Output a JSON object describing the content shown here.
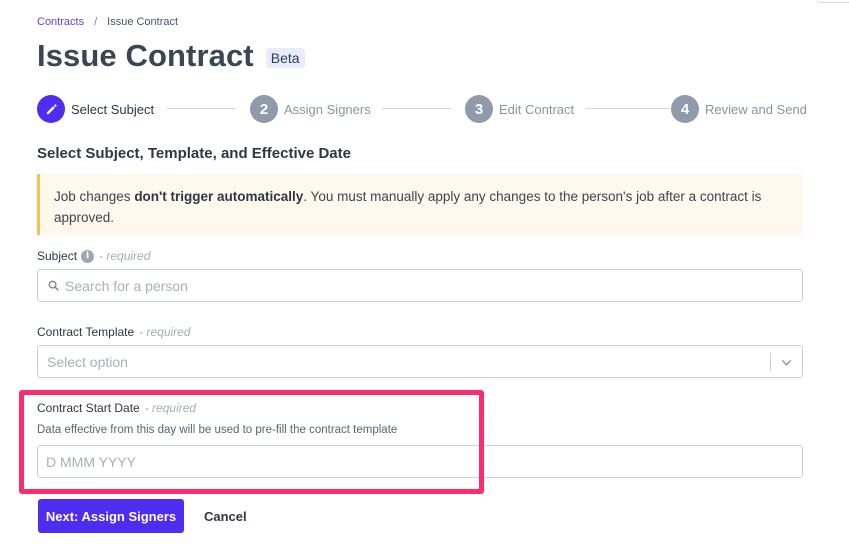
{
  "breadcrumb": {
    "parent": "Contracts",
    "separator": "/",
    "current": "Issue Contract"
  },
  "page": {
    "title": "Issue Contract",
    "badge": "Beta"
  },
  "stepper": {
    "steps": [
      {
        "number": "",
        "label": "Select Subject",
        "state": "active",
        "icon": "pencil-icon"
      },
      {
        "number": "2",
        "label": "Assign Signers",
        "state": "upcoming"
      },
      {
        "number": "3",
        "label": "Edit Contract",
        "state": "upcoming"
      },
      {
        "number": "4",
        "label": "Review and Send",
        "state": "upcoming"
      }
    ]
  },
  "section": {
    "title": "Select Subject, Template, and Effective Date"
  },
  "notice": {
    "text_before": "Job changes ",
    "text_bold": "don't trigger automatically",
    "text_after": ". You must manually apply any changes to the person's job after a contract is approved."
  },
  "form": {
    "subject": {
      "label": "Subject",
      "required_text": "- required",
      "placeholder": "Search for a person",
      "value": "",
      "icon": "search-icon"
    },
    "template": {
      "label": "Contract Template",
      "required_text": "- required",
      "placeholder": "Select option",
      "value": ""
    },
    "start_date": {
      "label": "Contract Start Date",
      "required_text": "- required",
      "helper": "Data effective from this day will be used to pre-fill the contract template",
      "placeholder": "D MMM YYYY",
      "value": ""
    }
  },
  "actions": {
    "next_label": "Next: Assign Signers",
    "cancel_label": "Cancel"
  },
  "colors": {
    "accent": "#4f2df0",
    "highlight": "#fb2d6d",
    "notice_bg": "#fff8ec",
    "notice_border": "#f2c253"
  }
}
